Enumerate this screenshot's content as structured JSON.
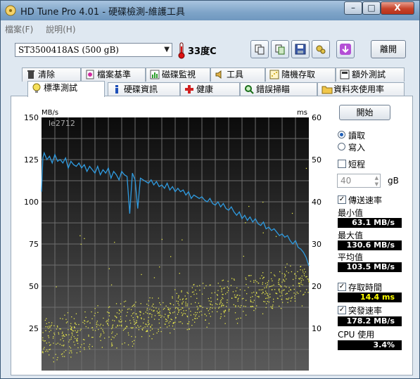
{
  "window": {
    "title": "HD Tune Pro 4.01 - 硬碟檢測-維護工具",
    "minimize": "–",
    "maximize": "□",
    "close": "X"
  },
  "menu": [
    "檔案(F)",
    "說明(H)"
  ],
  "toolbar": {
    "drive": "ST3500418AS (500 gB)",
    "temperature": "33度C",
    "exit_label": "離開",
    "buttons": [
      "copy-icon",
      "copy-all-icon",
      "save-icon",
      "settings-icon",
      "download-icon"
    ]
  },
  "tabs_row1": [
    "清除",
    "檔案基準",
    "磁碟監視",
    "工具",
    "隨機存取",
    "額外測試"
  ],
  "tabs_row2": [
    "標準測試",
    "硬碟資訊",
    "健康",
    "錯誤掃瞄",
    "資料夾使用率"
  ],
  "active_tab": "標準測試",
  "controls": {
    "start_label": "開始",
    "read_label": "讀取",
    "write_label": "寫入",
    "mode": "read",
    "short_label": "短程",
    "short_value": "40",
    "short_unit": "gB",
    "transfer_label": "傳送速率",
    "min_label": "最小值",
    "min_value": "63.1 MB/s",
    "max_label": "最大值",
    "max_value": "130.6 MB/s",
    "avg_label": "平均值",
    "avg_value": "103.5 MB/s",
    "access_label": "存取時間",
    "access_value": "14.4 ms",
    "burst_label": "突發速率",
    "burst_value": "178.2 MB/s",
    "cpu_label": "CPU 使用",
    "cpu_value": "3.4%"
  },
  "chart_data": {
    "type": "line",
    "watermark": "le2712",
    "left_unit": "MB/s",
    "right_unit": "ms",
    "left_ticks": [
      150,
      125,
      100,
      75,
      50,
      25
    ],
    "right_ticks": [
      60,
      50,
      40,
      30,
      20,
      10
    ],
    "ylim_left": [
      0,
      150
    ],
    "ylim_right": [
      0,
      60
    ],
    "x_range": [
      0,
      100
    ],
    "grid": true,
    "series": [
      {
        "type": "line",
        "color": "#2f9be0",
        "x": [
          0,
          0.5,
          1,
          2,
          3,
          4,
          5,
          6,
          7,
          8,
          9,
          10,
          11,
          12,
          13,
          14,
          15,
          16,
          17,
          18,
          19,
          20,
          21,
          22,
          23,
          24,
          25,
          26,
          27,
          28,
          29,
          30,
          31,
          32,
          33,
          34,
          35,
          36,
          37,
          38,
          39,
          40,
          41,
          42,
          43,
          44,
          45,
          46,
          47,
          48,
          49,
          50,
          51,
          52,
          53,
          54,
          55,
          56,
          57,
          58,
          59,
          60,
          61,
          62,
          63,
          64,
          65,
          66,
          67,
          68,
          69,
          70,
          71,
          72,
          73,
          74,
          75,
          76,
          77,
          78,
          79,
          80,
          81,
          82,
          83,
          84,
          85,
          86,
          87,
          88,
          89,
          90,
          91,
          92,
          93,
          94,
          95,
          96,
          97,
          98,
          99,
          100
        ],
        "y": [
          106,
          126,
          129,
          125,
          127,
          123,
          128,
          124,
          125,
          123,
          126,
          120,
          124,
          122,
          121,
          123,
          120,
          122,
          118,
          121,
          119,
          117,
          121,
          116,
          119,
          117,
          120,
          114,
          118,
          116,
          113,
          118,
          116,
          115,
          93,
          117,
          113,
          96,
          114,
          113,
          112,
          111,
          113,
          110,
          112,
          109,
          110,
          108,
          111,
          107,
          109,
          106,
          108,
          106,
          107,
          104,
          106,
          102,
          104,
          103,
          102,
          103,
          101,
          100,
          102,
          99,
          98,
          100,
          97,
          99,
          96,
          95,
          97,
          94,
          92,
          94,
          90,
          92,
          89,
          91,
          88,
          90,
          87,
          86,
          88,
          84,
          85,
          83,
          84,
          82,
          80,
          81,
          79,
          80,
          77,
          75,
          77,
          73,
          72,
          70,
          67,
          62
        ]
      },
      {
        "type": "scatter",
        "color": "#e7e74a",
        "name": "",
        "trend_x": [
          0,
          100
        ],
        "trend_y_ms": [
          7,
          21
        ],
        "spread_ms": [
          -6,
          6
        ],
        "count": 900
      }
    ]
  }
}
